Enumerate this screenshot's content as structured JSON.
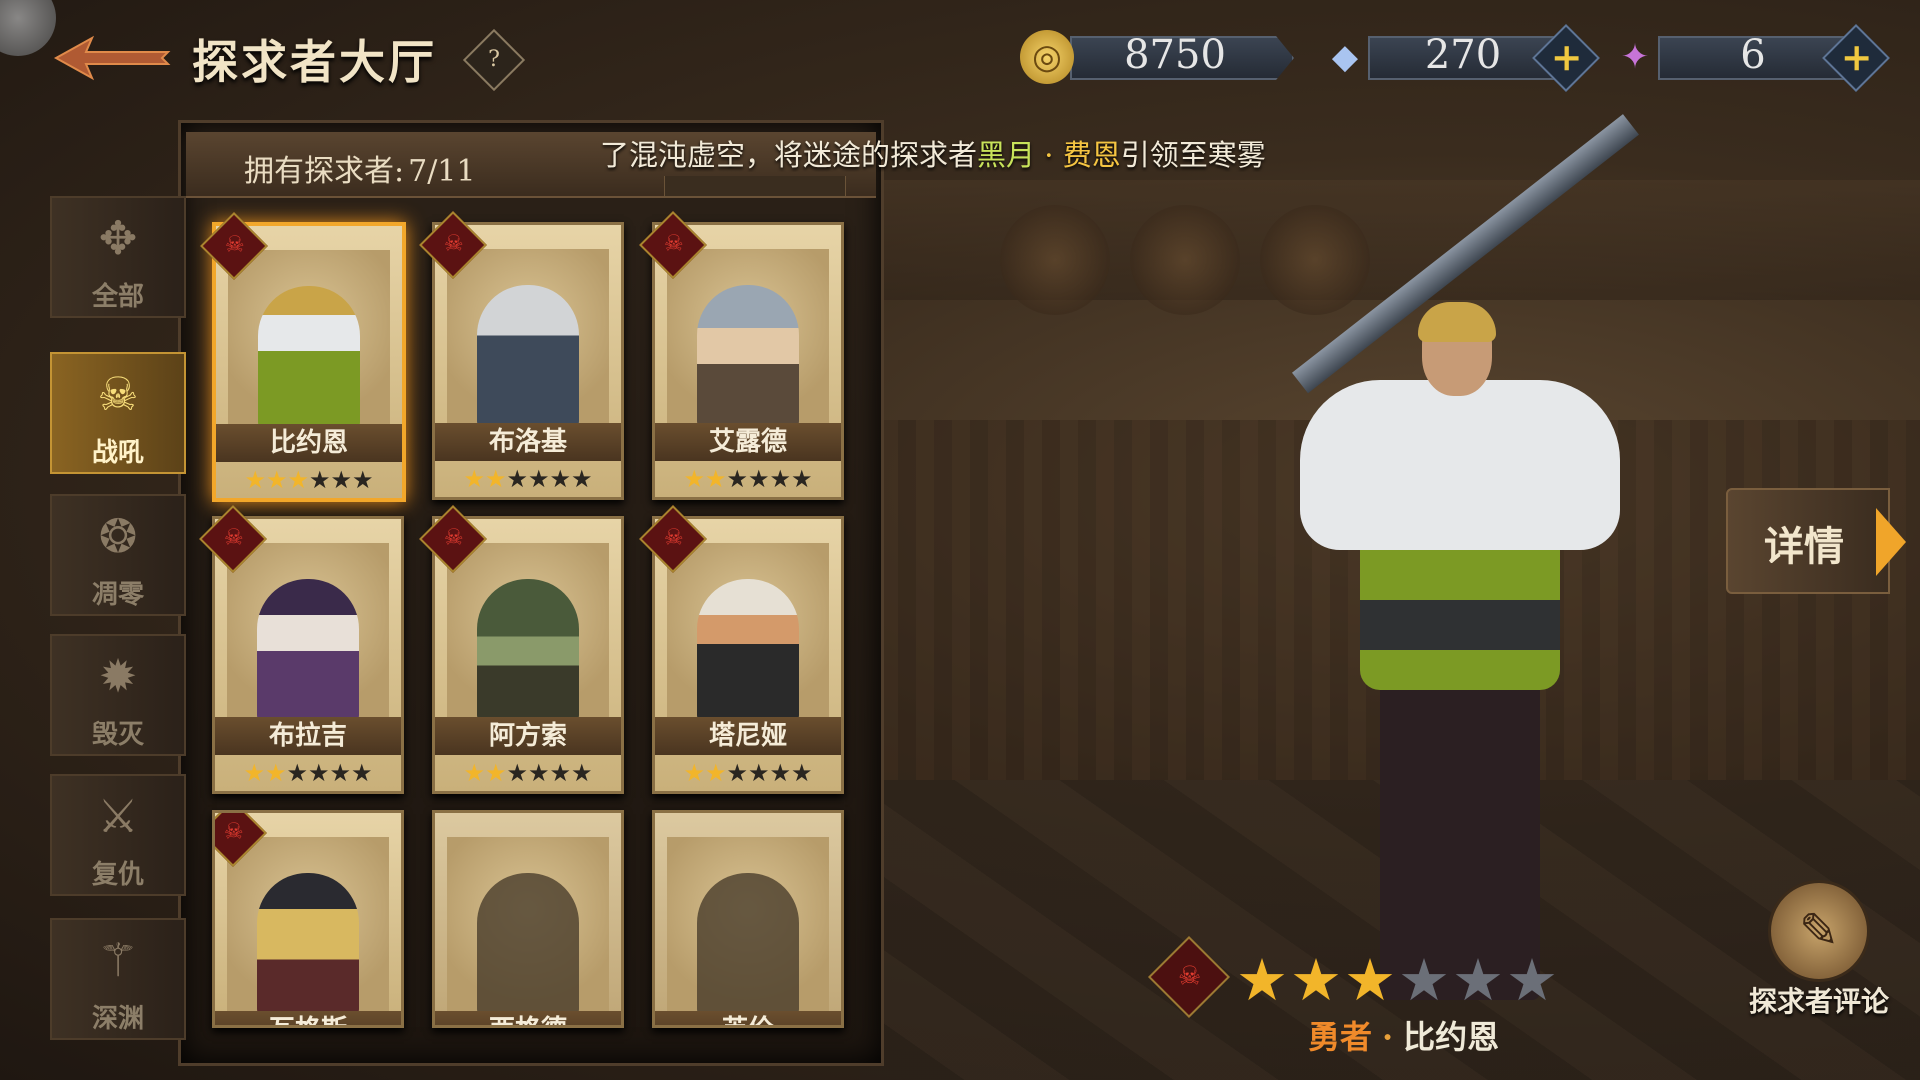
{
  "header": {
    "title": "探求者大厅",
    "help_icon": "?"
  },
  "currency": {
    "gold": "8750",
    "diamond": "270",
    "crystal": "6",
    "plus": "+"
  },
  "roster": {
    "owned_label": "拥有探求者:",
    "owned_count": "7/11"
  },
  "ticker": {
    "pre": "了混沌虚空，将迷途的探求者",
    "name_a": "黑月",
    "dot": "·",
    "name_b": "费恩",
    "post": "引领至寒雾"
  },
  "categories": [
    {
      "label": "全部",
      "icon": "all-icon"
    },
    {
      "label": "战吼",
      "icon": "warcry-icon",
      "active": true
    },
    {
      "label": "凋零",
      "icon": "wither-icon"
    },
    {
      "label": "毁灭",
      "icon": "ruin-icon"
    },
    {
      "label": "复仇",
      "icon": "revenge-icon"
    },
    {
      "label": "深渊",
      "icon": "abyss-icon"
    }
  ],
  "heroes": [
    {
      "name": "比约恩",
      "stars": 3,
      "max": 6,
      "selected": true
    },
    {
      "name": "布洛基",
      "stars": 2,
      "max": 6
    },
    {
      "name": "艾露德",
      "stars": 2,
      "max": 6
    },
    {
      "name": "布拉吉",
      "stars": 2,
      "max": 6
    },
    {
      "name": "阿方索",
      "stars": 2,
      "max": 6
    },
    {
      "name": "塔尼娅",
      "stars": 2,
      "max": 6
    },
    {
      "name": "瓦格斯",
      "locked": false
    },
    {
      "name": "西格德",
      "locked": true
    },
    {
      "name": "芙伦",
      "locked": true
    }
  ],
  "selected_hero": {
    "title": "勇者",
    "dot": "·",
    "name": "比约恩",
    "stars": 3,
    "max_stars": 6
  },
  "buttons": {
    "detail": "详情",
    "review": "探求者评论"
  },
  "colors": {
    "accent": "#f2a72a",
    "highlight_green": "#c8e35a",
    "highlight_gold": "#f5c542",
    "hero_title": "#f08a2a"
  }
}
